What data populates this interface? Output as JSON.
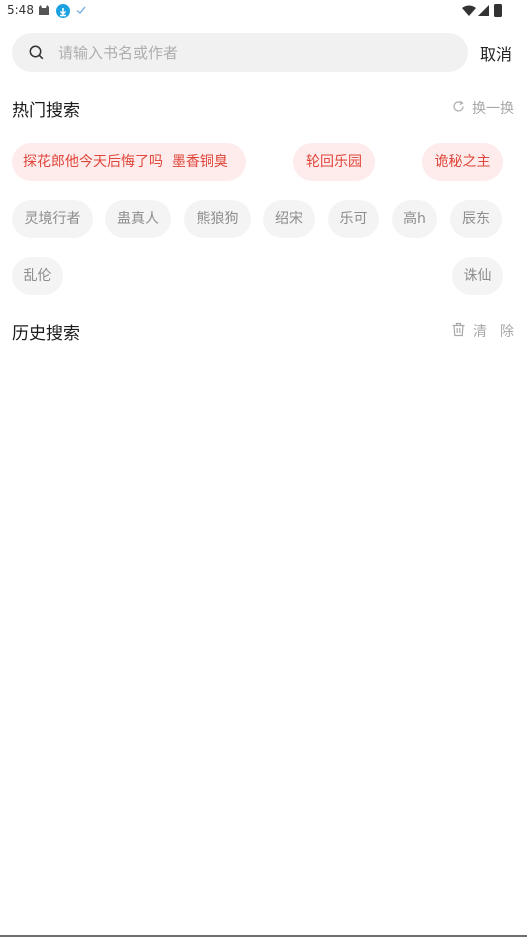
{
  "status_bar": {
    "time": "5:48"
  },
  "search": {
    "placeholder": "请输入书名或作者",
    "value": "",
    "cancel_label": "取消"
  },
  "hot": {
    "title": "热门搜索",
    "refresh_label": "换一换",
    "tags": [
      {
        "label": "探花郎他今天后悔了吗",
        "style": "hot"
      },
      {
        "label": "墨香铜臭",
        "style": "hot"
      },
      {
        "label": "轮回乐园",
        "style": "hot"
      },
      {
        "label": "诡秘之主",
        "style": "hot"
      },
      {
        "label": "灵境行者",
        "style": "normal"
      },
      {
        "label": "蛊真人",
        "style": "normal"
      },
      {
        "label": "熊狼狗",
        "style": "normal"
      },
      {
        "label": "绍宋",
        "style": "normal"
      },
      {
        "label": "乐可",
        "style": "normal"
      },
      {
        "label": "高h",
        "style": "normal"
      },
      {
        "label": "辰东",
        "style": "normal"
      },
      {
        "label": "乱伦",
        "style": "normal"
      },
      {
        "label": "诛仙",
        "style": "normal"
      }
    ]
  },
  "history": {
    "title": "历史搜索",
    "clear_label": "清除"
  },
  "colors": {
    "hot_tag_bg": "#fdeceb",
    "hot_tag_text": "#e0453a",
    "tag_bg": "#f4f4f4",
    "tag_text": "#8d8d8d",
    "download_badge": "#1ba1e2"
  },
  "icons": {
    "search": "search-icon",
    "refresh": "refresh-icon",
    "clear": "trash-icon"
  }
}
